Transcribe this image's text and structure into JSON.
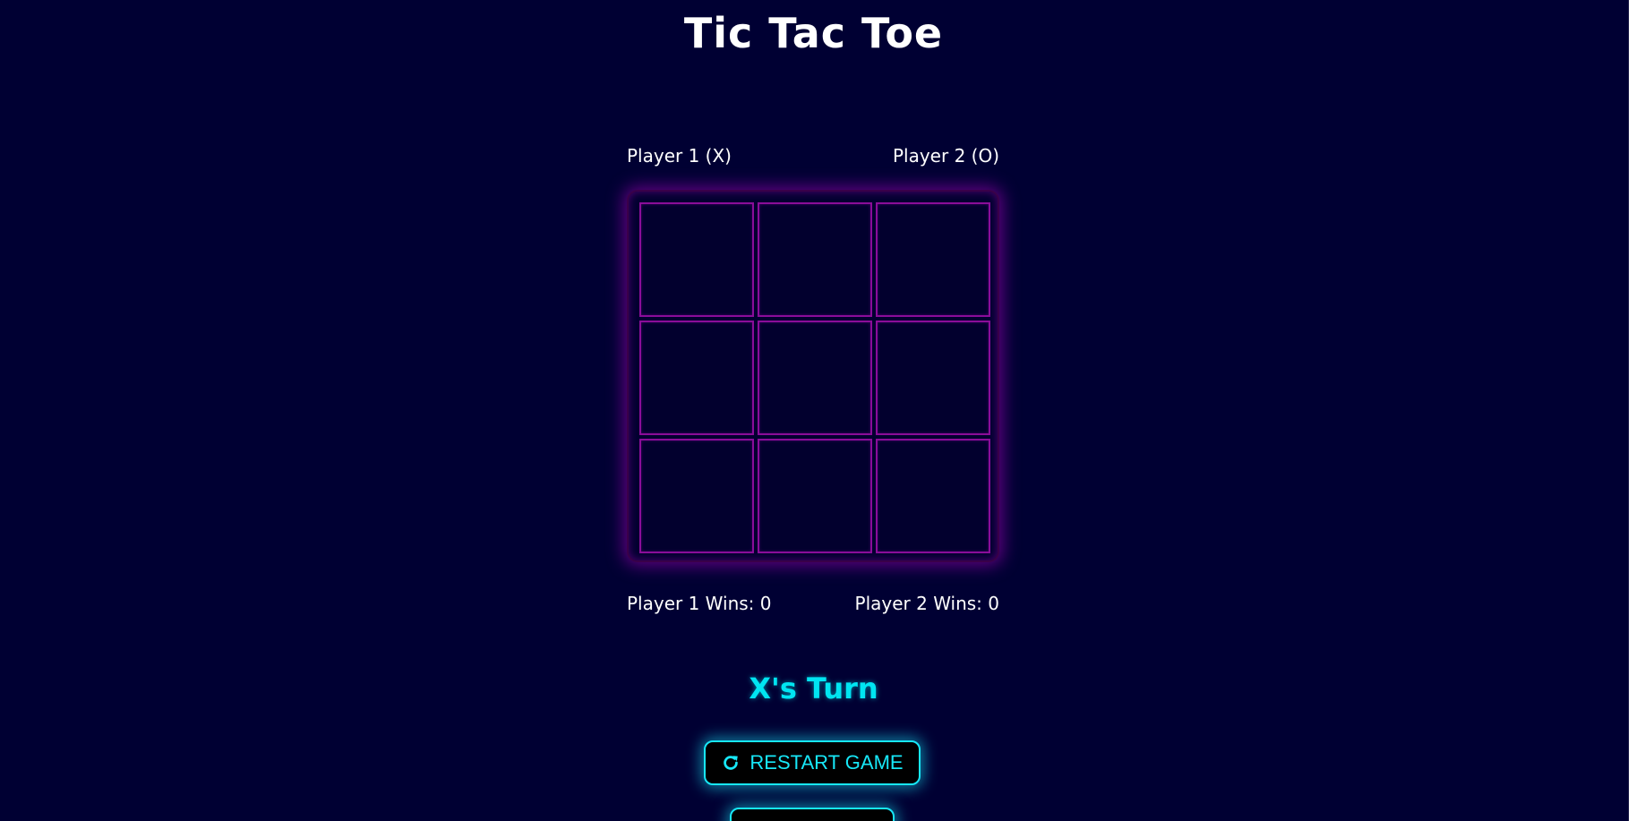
{
  "title": "Tic Tac Toe",
  "players": {
    "player1_label": "Player 1 (X)",
    "player2_label": "Player 2 (O)"
  },
  "board": {
    "cells": [
      "",
      "",
      "",
      "",
      "",
      "",
      "",
      "",
      ""
    ]
  },
  "wins": {
    "player1": "Player 1 Wins: 0",
    "player2": "Player 2 Wins: 0"
  },
  "turn": "X's Turn",
  "buttons": {
    "restart_label": "RESTART GAME",
    "restart_icon": "refresh-icon"
  },
  "colors": {
    "background": "#000033",
    "board_glow": "#aa00be",
    "cell_border": "#8a0d99",
    "accent": "#17e7f7",
    "turn_text": "#00e5f2"
  }
}
